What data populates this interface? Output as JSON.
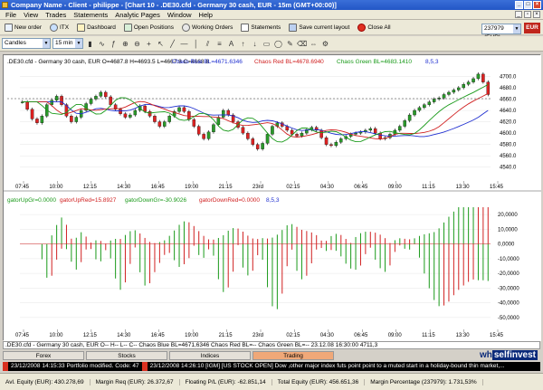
{
  "window": {
    "title": "Company Name - Client - philippe - [Chart 10 - .DE30.cfd - Germany 30 cash, EUR - 15m (GMT+00:00)]"
  },
  "menu": [
    "File",
    "View",
    "Trades",
    "Statements",
    "Analytic Pages",
    "Window",
    "Help"
  ],
  "toolbar": {
    "buttons": [
      "New order",
      "ITX",
      "Dashboard",
      "Open Positions",
      "Working Orders",
      "Statements",
      "Save current layout",
      "Close All"
    ],
    "account": "237979 (EUR)",
    "currency": "EUR"
  },
  "toolbar2": {
    "chart_type": "Candles",
    "timeframe": "15 min"
  },
  "chart": {
    "header": ".DE30.cfd - Germany 30 cash, EUR O=4687.8 H=4693.5 L=4667.8 C=4668.8",
    "legend": [
      "Chaos Blue BL=4671.6346",
      "Chaos Red BL=4678.6940",
      "Chaos Green BL=4683.1410",
      "8,5,3"
    ],
    "legend_colors": [
      "#1f2fd0",
      "#d02020",
      "#1a9a1a",
      "#1f2fd0"
    ],
    "price_ticks": [
      "4700.0",
      "4680.0",
      "4660.0",
      "4640.0",
      "4620.0",
      "4600.0",
      "4580.0",
      "4560.0",
      "4540.0"
    ],
    "gator_legend": [
      "gatorUpGr=0.0000",
      "gatorUpRed=15.8927",
      "gatorDownGr=-30.9026",
      "gatorDownRed=0.0000",
      "8,5,3"
    ],
    "gator_legend_colors": [
      "#1a9a1a",
      "#d02020",
      "#1a9a1a",
      "#d02020",
      "#1f2fd0"
    ],
    "gator_ticks": [
      "20,0000",
      "10,0000",
      "0,0000",
      "-10,0000",
      "-20,0000",
      "-30,0000",
      "-40,0000",
      "-50,0000"
    ],
    "time_ticks": [
      "07:45",
      "10:00",
      "12:15",
      "14:30",
      "16:45",
      "19:00",
      "21:15",
      "23rd",
      "02:15",
      "04:30",
      "06:45",
      "09:00",
      "11:15",
      "13:30",
      "15:45"
    ]
  },
  "chart_data": {
    "type": "candlestick",
    "title": ".DE30.cfd - Germany 30 cash, EUR",
    "ylim": [
      4530,
      4715
    ],
    "close_series": [
      4655,
      4642,
      4625,
      4618,
      4630,
      4650,
      4658,
      4665,
      4650,
      4630,
      4620,
      4628,
      4640,
      4652,
      4660,
      4665,
      4672,
      4664,
      4650,
      4642,
      4634,
      4628,
      4632,
      4640,
      4648,
      4638,
      4630,
      4620,
      4612,
      4620,
      4630,
      4638,
      4645,
      4638,
      4624,
      4612,
      4598,
      4590,
      4602,
      4615,
      4628,
      4640,
      4632,
      4620,
      4610,
      4600,
      4590,
      4580,
      4572,
      4582,
      4598,
      4612,
      4618,
      4612,
      4605,
      4598,
      4595,
      4600,
      4606,
      4610,
      4605,
      4592,
      4580,
      4578,
      4584,
      4590,
      4594,
      4598,
      4600,
      4602,
      4605,
      4608,
      4600,
      4590,
      4592,
      4598,
      4605,
      4612,
      4622,
      4632,
      4640,
      4645,
      4650,
      4655,
      4660,
      4662,
      4668,
      4672,
      4676,
      4680,
      4686,
      4690,
      4696,
      4704,
      4690,
      4668
    ],
    "gator_ylim": [
      -55,
      25
    ]
  }
}
